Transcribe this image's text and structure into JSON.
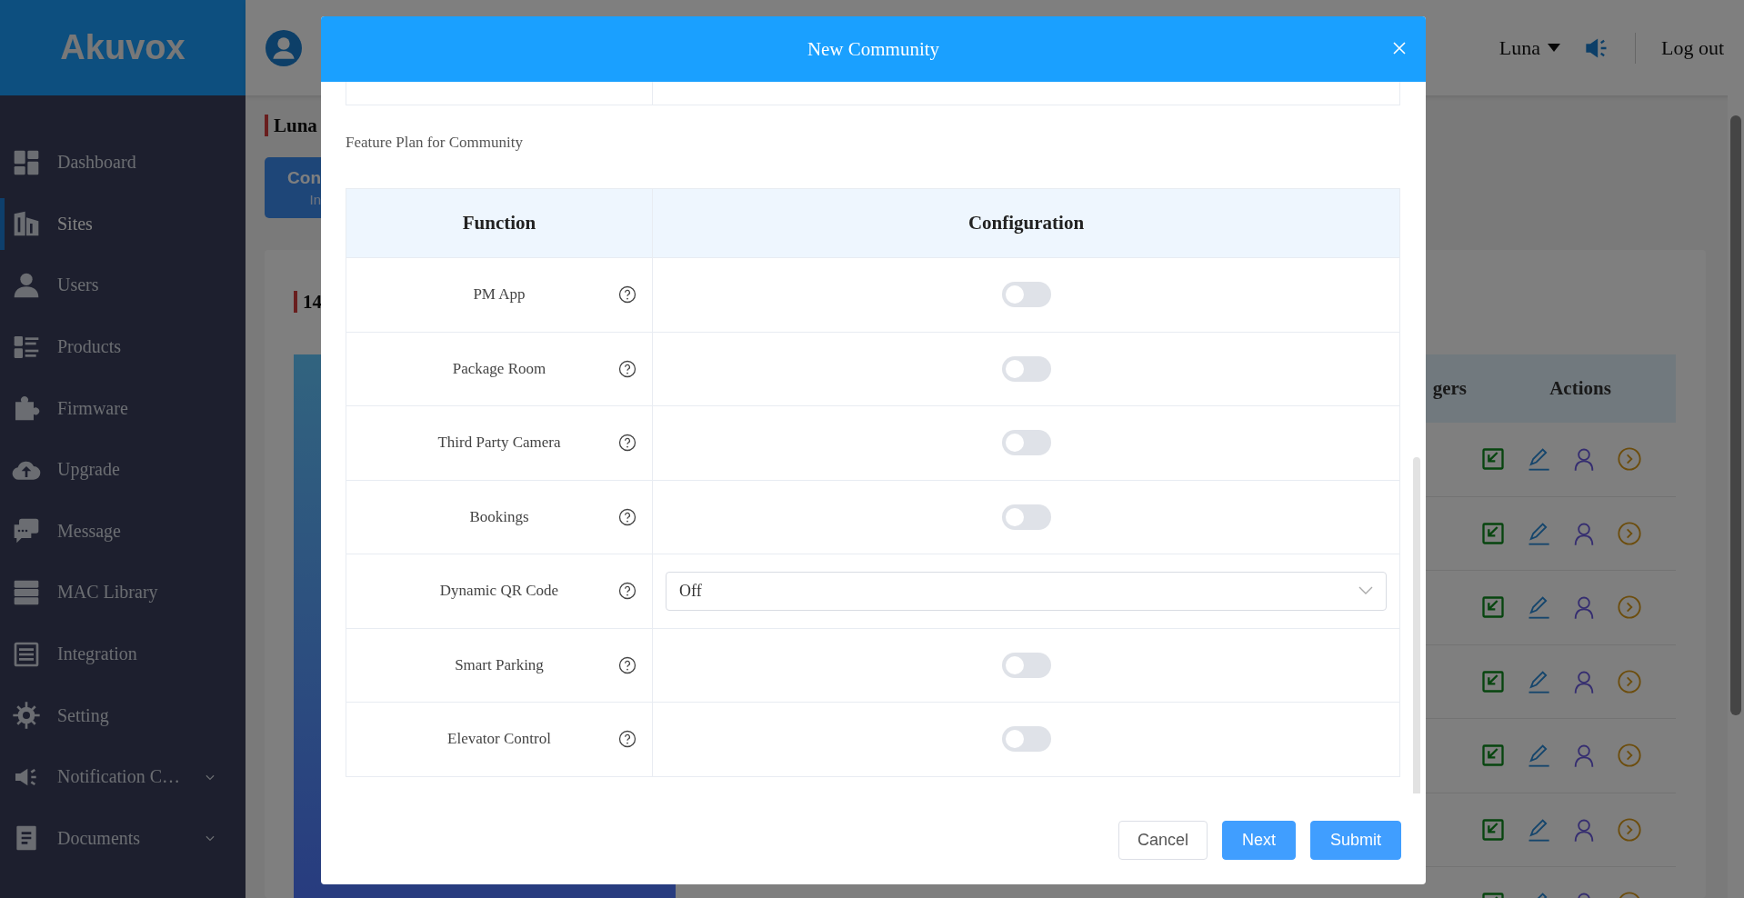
{
  "app": {
    "logo": "Akuvox",
    "user_menu": "Luna",
    "logout": "Log out"
  },
  "sidebar": {
    "items": [
      {
        "label": "Dashboard",
        "selected": false,
        "expandable": false
      },
      {
        "label": "Sites",
        "selected": true,
        "expandable": false
      },
      {
        "label": "Users",
        "selected": false,
        "expandable": false
      },
      {
        "label": "Products",
        "selected": false,
        "expandable": false
      },
      {
        "label": "Firmware",
        "selected": false,
        "expandable": false
      },
      {
        "label": "Upgrade",
        "selected": false,
        "expandable": false
      },
      {
        "label": "Message",
        "selected": false,
        "expandable": false
      },
      {
        "label": "MAC Library",
        "selected": false,
        "expandable": false
      },
      {
        "label": "Integration",
        "selected": false,
        "expandable": false
      },
      {
        "label": "Setting",
        "selected": false,
        "expandable": false
      },
      {
        "label": "Notification C…",
        "selected": false,
        "expandable": true
      },
      {
        "label": "Documents",
        "selected": false,
        "expandable": true
      }
    ]
  },
  "page": {
    "title": "Luna",
    "tab_button": {
      "title": "Con",
      "subtitle": "In"
    },
    "section_title": "14",
    "table": {
      "columns": [
        "gers",
        "Actions"
      ],
      "rows": [
        {
          "kind": "actions"
        },
        {
          "kind": "actions"
        },
        {
          "kind": "actions"
        },
        {
          "kind": "actions"
        },
        {
          "kind": "actions"
        },
        {
          "kind": "actions"
        },
        {
          "kind": "actions"
        }
      ]
    }
  },
  "modal": {
    "title": "New Community",
    "section_label": "Feature Plan for Community",
    "columns": [
      "Function",
      "Configuration"
    ],
    "features": [
      {
        "name": "PM App",
        "kind": "toggle",
        "on": false
      },
      {
        "name": "Package Room",
        "kind": "toggle",
        "on": false
      },
      {
        "name": "Third Party Camera",
        "kind": "toggle",
        "on": false
      },
      {
        "name": "Bookings",
        "kind": "toggle",
        "on": false
      },
      {
        "name": "Dynamic QR Code",
        "kind": "select",
        "value": "Off"
      },
      {
        "name": "Smart Parking",
        "kind": "toggle",
        "on": false
      },
      {
        "name": "Elevator Control",
        "kind": "toggle",
        "on": false
      }
    ],
    "buttons": [
      {
        "label": "Cancel",
        "kind": "secondary"
      },
      {
        "label": "Next",
        "kind": "primary"
      },
      {
        "label": "Submit",
        "kind": "primary"
      }
    ]
  }
}
